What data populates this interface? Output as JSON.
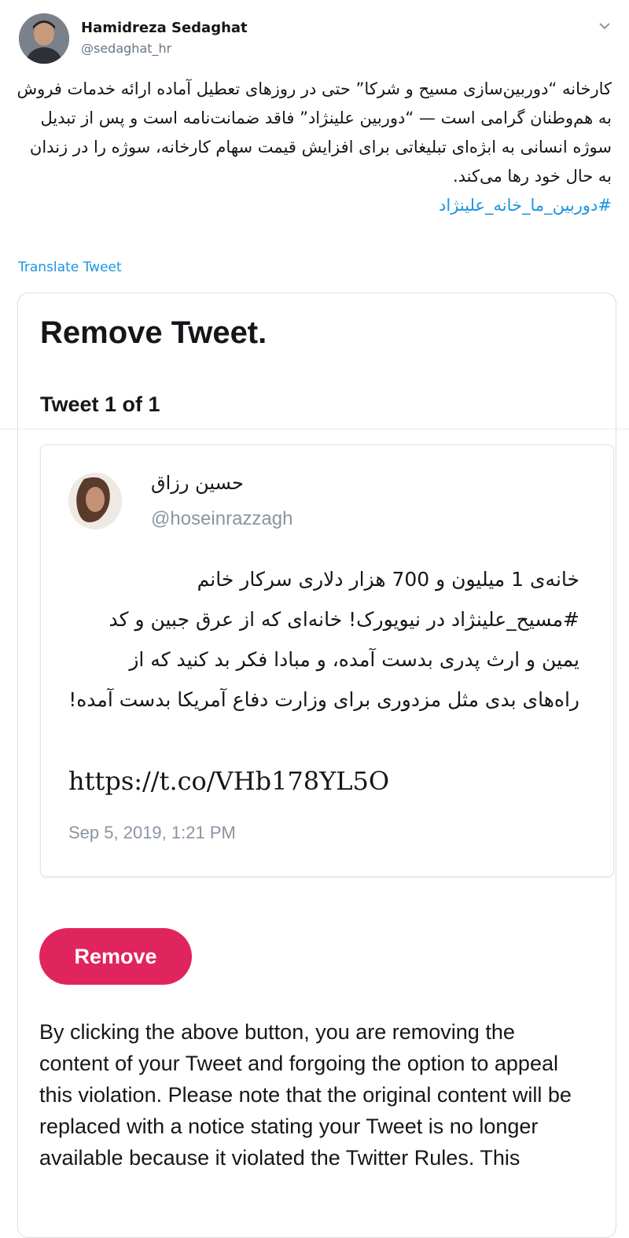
{
  "tweet": {
    "author_name": "Hamidreza Sedaghat",
    "author_handle": "@sedaghat_hr",
    "text": "کارخانه “دوربین‌سازی مسیح و شرکا” حتی در روزهای تعطیل آماده ارائه خدمات فروش به هم‌وطنان گرامی است — “دوربین علینژاد” فاقد ضمانت‌نامه است و پس از تبدیل سوژه انسانی به ابژه‌ای تبلیغاتی برای افزایش قیمت سهام کارخانه، سوژه را در زندان به حال خود رها می‌کند.",
    "hashtag": "#دوربین_ما_خانه_علینژاد",
    "translate_label": "Translate Tweet"
  },
  "dialog": {
    "title": "Remove Tweet.",
    "count_label": "Tweet 1 of 1",
    "remove_button": "Remove",
    "notice": "By clicking the above button, you are removing the content of your Tweet and forgoing the option to appeal this violation. Please note that the original content will be replaced with a notice stating your Tweet is no longer available because it violated the Twitter Rules. This"
  },
  "quoted": {
    "name": "حسین رزاق",
    "handle": "@hoseinrazzagh",
    "text": "خانه‌ی 1 میلیون و 700 هزار دلاری سرکار خانم #مسیح_علینژاد در نیویورک! خانه‌ای که از عرق جبین و کد یمین و ارث پدری بدست آمده، و مبادا فکر بد کنید که از راه‌های بدی مثل مزدوری برای وزارت دفاع آمریکا بدست آمده!",
    "link": "https://t.co/VHb178YL5O",
    "date": "Sep 5, 2019, 1:21 PM"
  },
  "icons": {
    "chevron": "chevron-down-icon"
  },
  "colors": {
    "link_blue": "#1b95e0",
    "remove_red": "#e0245e",
    "secondary_gray": "#657786"
  }
}
